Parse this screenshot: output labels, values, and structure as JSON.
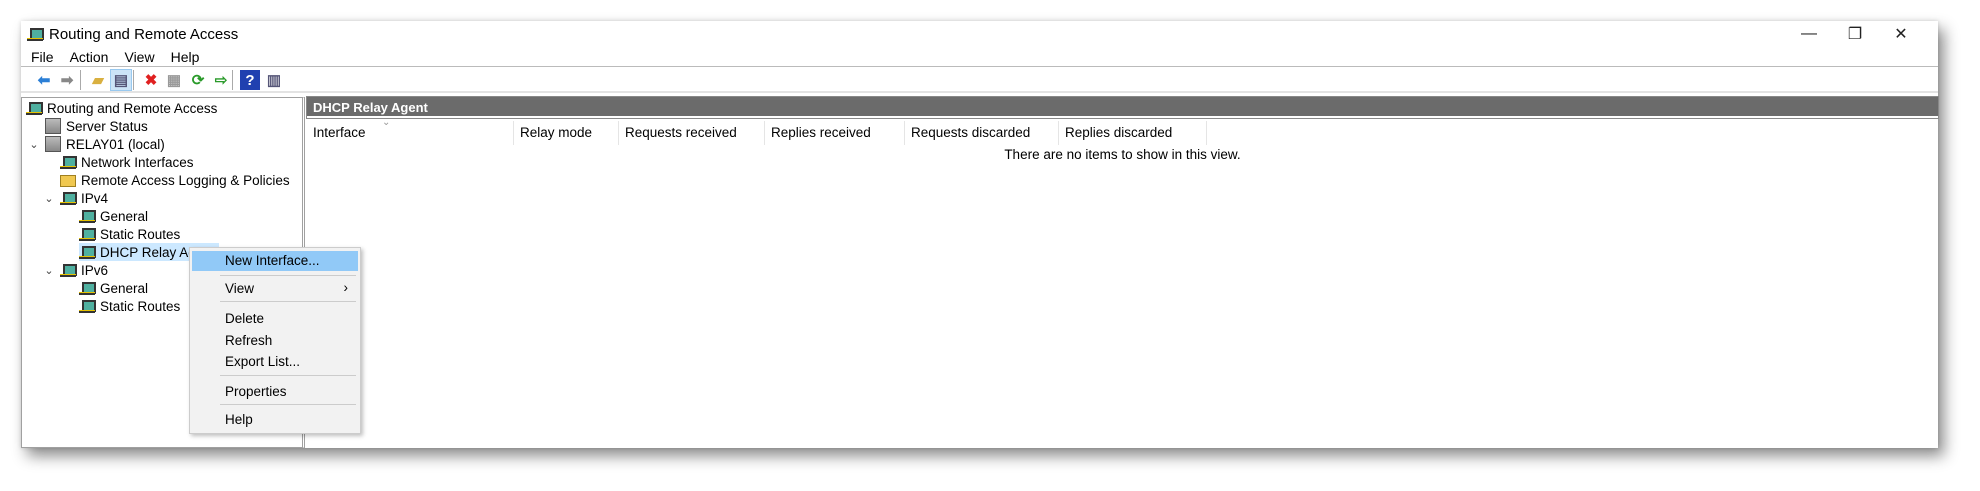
{
  "window": {
    "title": "Routing and Remote Access",
    "minimize": "—",
    "restore": "❐",
    "close": "✕"
  },
  "menubar": [
    "File",
    "Action",
    "View",
    "Help"
  ],
  "toolbar": [
    {
      "name": "back-icon",
      "glyph": "⬅",
      "color": "#2b7fd6"
    },
    {
      "name": "forward-icon",
      "glyph": "➡",
      "color": "#888888"
    },
    {
      "name": "up-folder-icon",
      "glyph": "▰",
      "color": "#d9b040"
    },
    {
      "name": "show-hide-tree-icon",
      "glyph": "▤",
      "color": "#557"
    },
    {
      "name": "delete-icon",
      "glyph": "✖",
      "color": "#e02020"
    },
    {
      "name": "properties-icon",
      "glyph": "▦",
      "color": "#999"
    },
    {
      "name": "refresh-icon",
      "glyph": "⟳",
      "color": "#2a9a2a"
    },
    {
      "name": "export-list-icon",
      "glyph": "⇨",
      "color": "#2a9a2a"
    },
    {
      "name": "help-icon",
      "glyph": "?",
      "color": "#ffffff"
    },
    {
      "name": "show-action-pane-icon",
      "glyph": "▥",
      "color": "#557"
    }
  ],
  "tree": [
    {
      "label": "Routing and Remote Access",
      "icon": "net",
      "level": 0,
      "chev": ""
    },
    {
      "label": "Server Status",
      "icon": "srv",
      "level": 1,
      "chev": ""
    },
    {
      "label": "RELAY01 (local)",
      "icon": "srv",
      "level": 1,
      "chev": "⌄"
    },
    {
      "label": "Network Interfaces",
      "icon": "net",
      "level": 2,
      "chev": ""
    },
    {
      "label": "Remote Access Logging & Policies",
      "icon": "fold",
      "level": 2,
      "chev": ""
    },
    {
      "label": "IPv4",
      "icon": "net",
      "level": 2,
      "chev": "⌄"
    },
    {
      "label": "General",
      "icon": "net",
      "level": 3,
      "chev": ""
    },
    {
      "label": "Static Routes",
      "icon": "net",
      "level": 3,
      "chev": ""
    },
    {
      "label": "DHCP Relay Agent",
      "icon": "net",
      "level": 3,
      "chev": "",
      "selected": true
    },
    {
      "label": "IPv6",
      "icon": "net",
      "level": 2,
      "chev": "⌄"
    },
    {
      "label": "General",
      "icon": "net",
      "level": 3,
      "chev": ""
    },
    {
      "label": "Static Routes",
      "icon": "net",
      "level": 3,
      "chev": ""
    }
  ],
  "pane": {
    "title": "DHCP Relay Agent",
    "columns": [
      "Interface",
      "Relay mode",
      "Requests received",
      "Replies received",
      "Requests discarded",
      "Replies discarded"
    ],
    "sort_indicator": "⌄",
    "empty": "There are no items to show in this view."
  },
  "context_menu": {
    "items": [
      "New Interface...",
      "View",
      "Delete",
      "Refresh",
      "Export List...",
      "Properties",
      "Help"
    ],
    "submenu_arrow": "›"
  }
}
